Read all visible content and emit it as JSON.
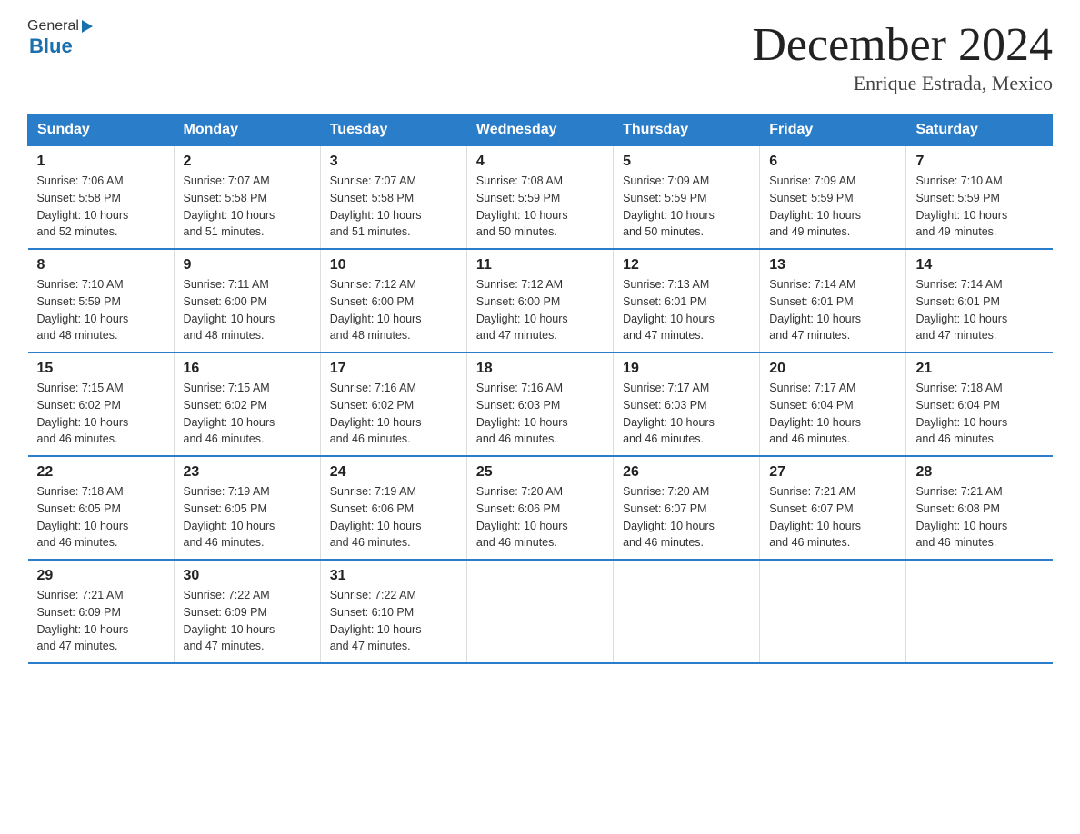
{
  "header": {
    "logo_general": "General",
    "logo_blue": "Blue",
    "title": "December 2024",
    "subtitle": "Enrique Estrada, Mexico"
  },
  "days_of_week": [
    "Sunday",
    "Monday",
    "Tuesday",
    "Wednesday",
    "Thursday",
    "Friday",
    "Saturday"
  ],
  "weeks": [
    [
      {
        "day": "1",
        "sunrise": "7:06 AM",
        "sunset": "5:58 PM",
        "daylight": "10 hours and 52 minutes."
      },
      {
        "day": "2",
        "sunrise": "7:07 AM",
        "sunset": "5:58 PM",
        "daylight": "10 hours and 51 minutes."
      },
      {
        "day": "3",
        "sunrise": "7:07 AM",
        "sunset": "5:58 PM",
        "daylight": "10 hours and 51 minutes."
      },
      {
        "day": "4",
        "sunrise": "7:08 AM",
        "sunset": "5:59 PM",
        "daylight": "10 hours and 50 minutes."
      },
      {
        "day": "5",
        "sunrise": "7:09 AM",
        "sunset": "5:59 PM",
        "daylight": "10 hours and 50 minutes."
      },
      {
        "day": "6",
        "sunrise": "7:09 AM",
        "sunset": "5:59 PM",
        "daylight": "10 hours and 49 minutes."
      },
      {
        "day": "7",
        "sunrise": "7:10 AM",
        "sunset": "5:59 PM",
        "daylight": "10 hours and 49 minutes."
      }
    ],
    [
      {
        "day": "8",
        "sunrise": "7:10 AM",
        "sunset": "5:59 PM",
        "daylight": "10 hours and 48 minutes."
      },
      {
        "day": "9",
        "sunrise": "7:11 AM",
        "sunset": "6:00 PM",
        "daylight": "10 hours and 48 minutes."
      },
      {
        "day": "10",
        "sunrise": "7:12 AM",
        "sunset": "6:00 PM",
        "daylight": "10 hours and 48 minutes."
      },
      {
        "day": "11",
        "sunrise": "7:12 AM",
        "sunset": "6:00 PM",
        "daylight": "10 hours and 47 minutes."
      },
      {
        "day": "12",
        "sunrise": "7:13 AM",
        "sunset": "6:01 PM",
        "daylight": "10 hours and 47 minutes."
      },
      {
        "day": "13",
        "sunrise": "7:14 AM",
        "sunset": "6:01 PM",
        "daylight": "10 hours and 47 minutes."
      },
      {
        "day": "14",
        "sunrise": "7:14 AM",
        "sunset": "6:01 PM",
        "daylight": "10 hours and 47 minutes."
      }
    ],
    [
      {
        "day": "15",
        "sunrise": "7:15 AM",
        "sunset": "6:02 PM",
        "daylight": "10 hours and 46 minutes."
      },
      {
        "day": "16",
        "sunrise": "7:15 AM",
        "sunset": "6:02 PM",
        "daylight": "10 hours and 46 minutes."
      },
      {
        "day": "17",
        "sunrise": "7:16 AM",
        "sunset": "6:02 PM",
        "daylight": "10 hours and 46 minutes."
      },
      {
        "day": "18",
        "sunrise": "7:16 AM",
        "sunset": "6:03 PM",
        "daylight": "10 hours and 46 minutes."
      },
      {
        "day": "19",
        "sunrise": "7:17 AM",
        "sunset": "6:03 PM",
        "daylight": "10 hours and 46 minutes."
      },
      {
        "day": "20",
        "sunrise": "7:17 AM",
        "sunset": "6:04 PM",
        "daylight": "10 hours and 46 minutes."
      },
      {
        "day": "21",
        "sunrise": "7:18 AM",
        "sunset": "6:04 PM",
        "daylight": "10 hours and 46 minutes."
      }
    ],
    [
      {
        "day": "22",
        "sunrise": "7:18 AM",
        "sunset": "6:05 PM",
        "daylight": "10 hours and 46 minutes."
      },
      {
        "day": "23",
        "sunrise": "7:19 AM",
        "sunset": "6:05 PM",
        "daylight": "10 hours and 46 minutes."
      },
      {
        "day": "24",
        "sunrise": "7:19 AM",
        "sunset": "6:06 PM",
        "daylight": "10 hours and 46 minutes."
      },
      {
        "day": "25",
        "sunrise": "7:20 AM",
        "sunset": "6:06 PM",
        "daylight": "10 hours and 46 minutes."
      },
      {
        "day": "26",
        "sunrise": "7:20 AM",
        "sunset": "6:07 PM",
        "daylight": "10 hours and 46 minutes."
      },
      {
        "day": "27",
        "sunrise": "7:21 AM",
        "sunset": "6:07 PM",
        "daylight": "10 hours and 46 minutes."
      },
      {
        "day": "28",
        "sunrise": "7:21 AM",
        "sunset": "6:08 PM",
        "daylight": "10 hours and 46 minutes."
      }
    ],
    [
      {
        "day": "29",
        "sunrise": "7:21 AM",
        "sunset": "6:09 PM",
        "daylight": "10 hours and 47 minutes."
      },
      {
        "day": "30",
        "sunrise": "7:22 AM",
        "sunset": "6:09 PM",
        "daylight": "10 hours and 47 minutes."
      },
      {
        "day": "31",
        "sunrise": "7:22 AM",
        "sunset": "6:10 PM",
        "daylight": "10 hours and 47 minutes."
      },
      null,
      null,
      null,
      null
    ]
  ],
  "labels": {
    "sunrise": "Sunrise:",
    "sunset": "Sunset:",
    "daylight": "Daylight:"
  }
}
